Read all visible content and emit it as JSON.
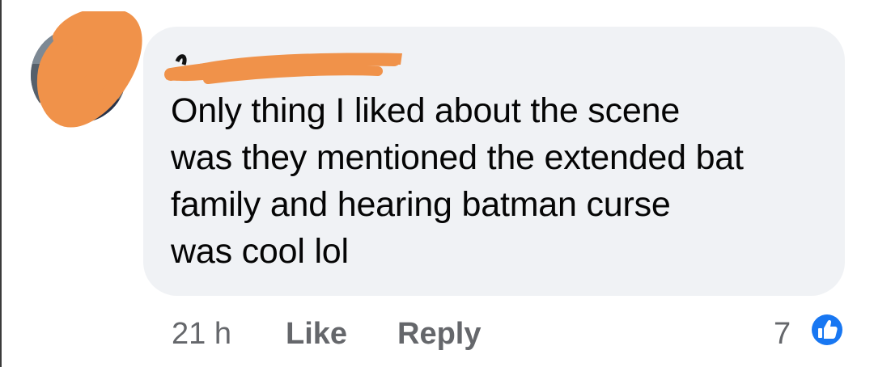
{
  "comment": {
    "author": "",
    "text": "Only thing I liked about the scene was they mentioned the extended bat family and hearing batman curse was cool lol",
    "text_lines": [
      "Only thing I liked about the scene",
      "was they mentioned the extended bat",
      "family and hearing batman curse",
      "was cool lol"
    ]
  },
  "actions": {
    "timestamp": "21 h",
    "like_label": "Like",
    "reply_label": "Reply"
  },
  "reactions": {
    "count": "7",
    "icon": "thumbs-up-icon",
    "color": "#1877f2"
  },
  "colors": {
    "bubble": "#f0f2f5",
    "text": "#050505",
    "meta": "#65676b",
    "redaction": "#f0924a"
  }
}
